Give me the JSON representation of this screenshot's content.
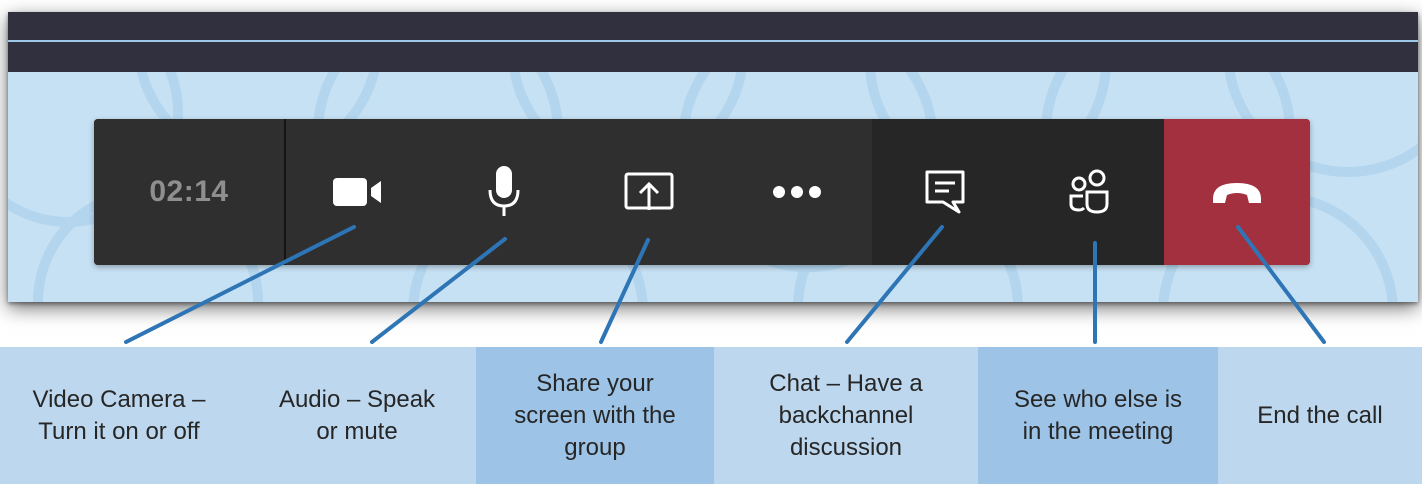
{
  "meeting_bar": {
    "timer": "02:14",
    "controls": [
      {
        "name": "video-camera",
        "icon": "video-camera-icon"
      },
      {
        "name": "microphone",
        "icon": "microphone-icon"
      },
      {
        "name": "share-screen",
        "icon": "share-screen-icon"
      },
      {
        "name": "more-options",
        "icon": "more-options-icon"
      },
      {
        "name": "chat",
        "icon": "chat-icon"
      },
      {
        "name": "participants",
        "icon": "participants-icon"
      },
      {
        "name": "hang-up",
        "icon": "hang-up-icon"
      }
    ]
  },
  "callouts": {
    "video": "Video Camera –\nTurn it on or off",
    "audio": "Audio – Speak\nor mute",
    "share": "Share your\nscreen with the\ngroup",
    "chat": "Chat – Have a\nbackchannel\ndiscussion",
    "participants": "See who else is\nin the meeting",
    "end_call": "End the call"
  },
  "colors": {
    "title_strip": "#31303f",
    "background": "#c6e1f3",
    "bar": "#2f2f2f",
    "bar_right": "#262626",
    "hang_up": "#a3303f",
    "leader_line": "#2e75b6",
    "callout_light": "#bdd7ee",
    "callout_dark": "#9dc3e6"
  }
}
